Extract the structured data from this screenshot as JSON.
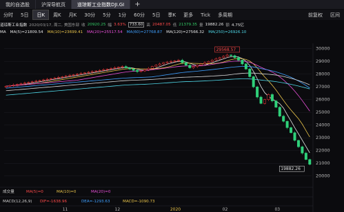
{
  "tabs": [
    {
      "label": "我的自选股",
      "active": false
    },
    {
      "label": "沪深导航页",
      "active": false
    },
    {
      "label": "道琼斯工业指数DJI.GI",
      "active": true
    }
  ],
  "new_tab_label": "+",
  "periods": [
    "分时",
    "5日",
    "日K",
    "周K",
    "月K",
    "30分",
    "5分",
    "1分",
    "60分",
    "5日",
    "季K",
    "更多",
    "Tick",
    "多周期"
  ],
  "active_period": "日K",
  "right_buttons": [
    "前复权",
    "区间"
  ],
  "info": {
    "name": "道琼斯工业指数",
    "date": "2020/03/17, 周二, 美国东部",
    "close_label": "收",
    "close": "20920.25",
    "change_label": "幅",
    "change_pct": "3.63%",
    "volume_box": "733.60",
    "high_label": "高",
    "high": "20487.05",
    "low_label": "低",
    "low": "21379.35",
    "extra_label": "量",
    "extra": "19882.26",
    "amount_label": "额",
    "amount": "4.75亿"
  },
  "ma": {
    "label": "MA",
    "ma5": "MA(5)=21809.54",
    "ma10": "MA(10)=23699.41",
    "ma20": "MA(20)=25517.54",
    "ma60": "MA(60)=27768.87",
    "ma120": "MA(120)=27566.32",
    "ma250": "MA(250)=26926.10"
  },
  "price_axis": [
    "30000",
    "29000",
    "28000",
    "27000",
    "26000",
    "25000",
    "24000",
    "23000",
    "22000",
    "21000",
    "20000"
  ],
  "high_marker": "29568.57",
  "low_marker": "19882.26",
  "time_axis": [
    "11",
    "12",
    "2020",
    "02",
    "03"
  ],
  "volume_panel": {
    "label": "成交量",
    "ma5": "MA(5)=0",
    "ma10": "MA(10)=0",
    "ma20": "MA(20)=0"
  },
  "macd_panel": {
    "label": "MACD(12,26,9)",
    "dif": "DIF=-1638.96",
    "dea": "DEA=-1293.63",
    "macd": "MACD=-1090.73"
  },
  "colors": {
    "up": "#ff3b3b",
    "down": "#2fd17a",
    "ma5": "#e8e8e8",
    "ma10": "#e8c34a",
    "ma20": "#e84fd8",
    "ma60": "#3fa0ff",
    "ma120": "#d8d8d8",
    "ma250": "#4fd8e8",
    "background": "#0b0b0e"
  },
  "chart_data": {
    "type": "candlestick",
    "ylim": [
      19500,
      30200
    ],
    "closes": [
      27050,
      27100,
      27150,
      27200,
      27250,
      27300,
      27350,
      27400,
      27450,
      27500,
      27550,
      27600,
      27650,
      27700,
      27750,
      27800,
      27850,
      27900,
      27950,
      28000,
      28050,
      28100,
      28150,
      28200,
      28250,
      28300,
      28350,
      28400,
      28450,
      28500,
      28550,
      28600,
      28500,
      28400,
      28300,
      28200,
      28250,
      28350,
      28450,
      28600,
      28700,
      28800,
      28900,
      28950,
      29000,
      29050,
      29100,
      28900,
      28700,
      28500,
      28600,
      28700,
      28800,
      28900,
      29000,
      29100,
      29200,
      29300,
      29400,
      29500,
      29450,
      29300,
      29100,
      28800,
      28400,
      27800,
      27000,
      26200,
      25700,
      26000,
      26400,
      25900,
      25400,
      24700,
      24300,
      23800,
      23400,
      22800,
      22300,
      21800,
      21300,
      20920
    ]
  }
}
